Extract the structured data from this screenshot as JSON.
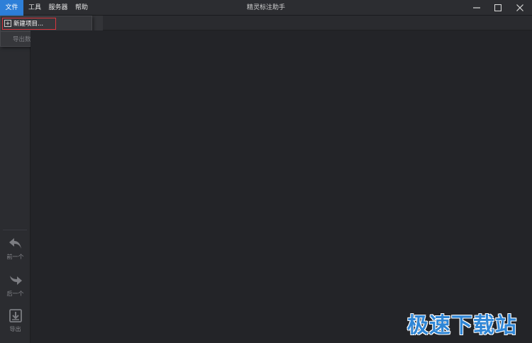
{
  "app": {
    "title": "精灵标注助手"
  },
  "menubar": {
    "items": [
      {
        "label": "文件",
        "active": true
      },
      {
        "label": "工具",
        "active": false
      },
      {
        "label": "服务器",
        "active": false
      },
      {
        "label": "帮助",
        "active": false
      }
    ]
  },
  "file_menu": {
    "items": [
      {
        "label": "新建项目...",
        "enabled": true,
        "icon": "new-project-icon"
      },
      {
        "label": "导出数据...",
        "enabled": false
      }
    ]
  },
  "sidebar": {
    "items": [
      {
        "label": "前一个",
        "icon": "undo-arrow-icon"
      },
      {
        "label": "后一个",
        "icon": "redo-arrow-icon"
      },
      {
        "label": "导出",
        "icon": "export-icon"
      }
    ]
  },
  "window_controls": {
    "icons": [
      "minimize-icon",
      "maximize-icon",
      "close-icon"
    ]
  },
  "watermark": {
    "text": "极速下载站"
  },
  "colors": {
    "accent": "#2d7fd8",
    "highlight_border": "#d9363e",
    "background": "#232428",
    "watermark": "#2f86d6"
  }
}
